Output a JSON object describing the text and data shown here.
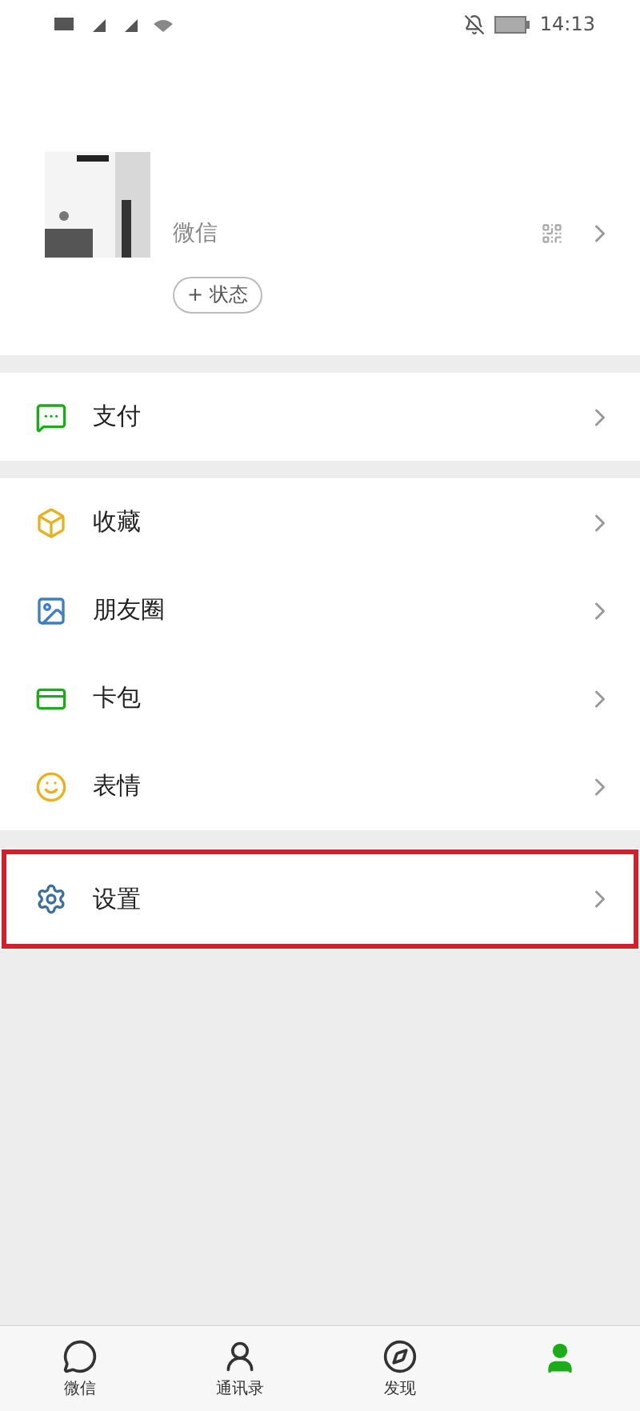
{
  "status_bar": {
    "time": "14:13"
  },
  "profile": {
    "wechat_id_label": "微信",
    "status_button": "+ 状态"
  },
  "groups": [
    {
      "items": [
        {
          "kind": "pay",
          "label": "支付",
          "highlighted": false
        }
      ]
    },
    {
      "items": [
        {
          "kind": "favorites",
          "label": "收藏",
          "highlighted": false
        },
        {
          "kind": "moments",
          "label": "朋友圈",
          "highlighted": false
        },
        {
          "kind": "cards",
          "label": "卡包",
          "highlighted": false
        },
        {
          "kind": "stickers",
          "label": "表情",
          "highlighted": false
        }
      ]
    },
    {
      "items": [
        {
          "kind": "settings",
          "label": "设置",
          "highlighted": true
        }
      ]
    }
  ],
  "tab_bar": [
    {
      "kind": "chats",
      "label": "微信",
      "selected": false
    },
    {
      "kind": "contacts",
      "label": "通讯录",
      "selected": false
    },
    {
      "kind": "discover",
      "label": "发现",
      "selected": false
    },
    {
      "kind": "me",
      "selected": true
    }
  ]
}
